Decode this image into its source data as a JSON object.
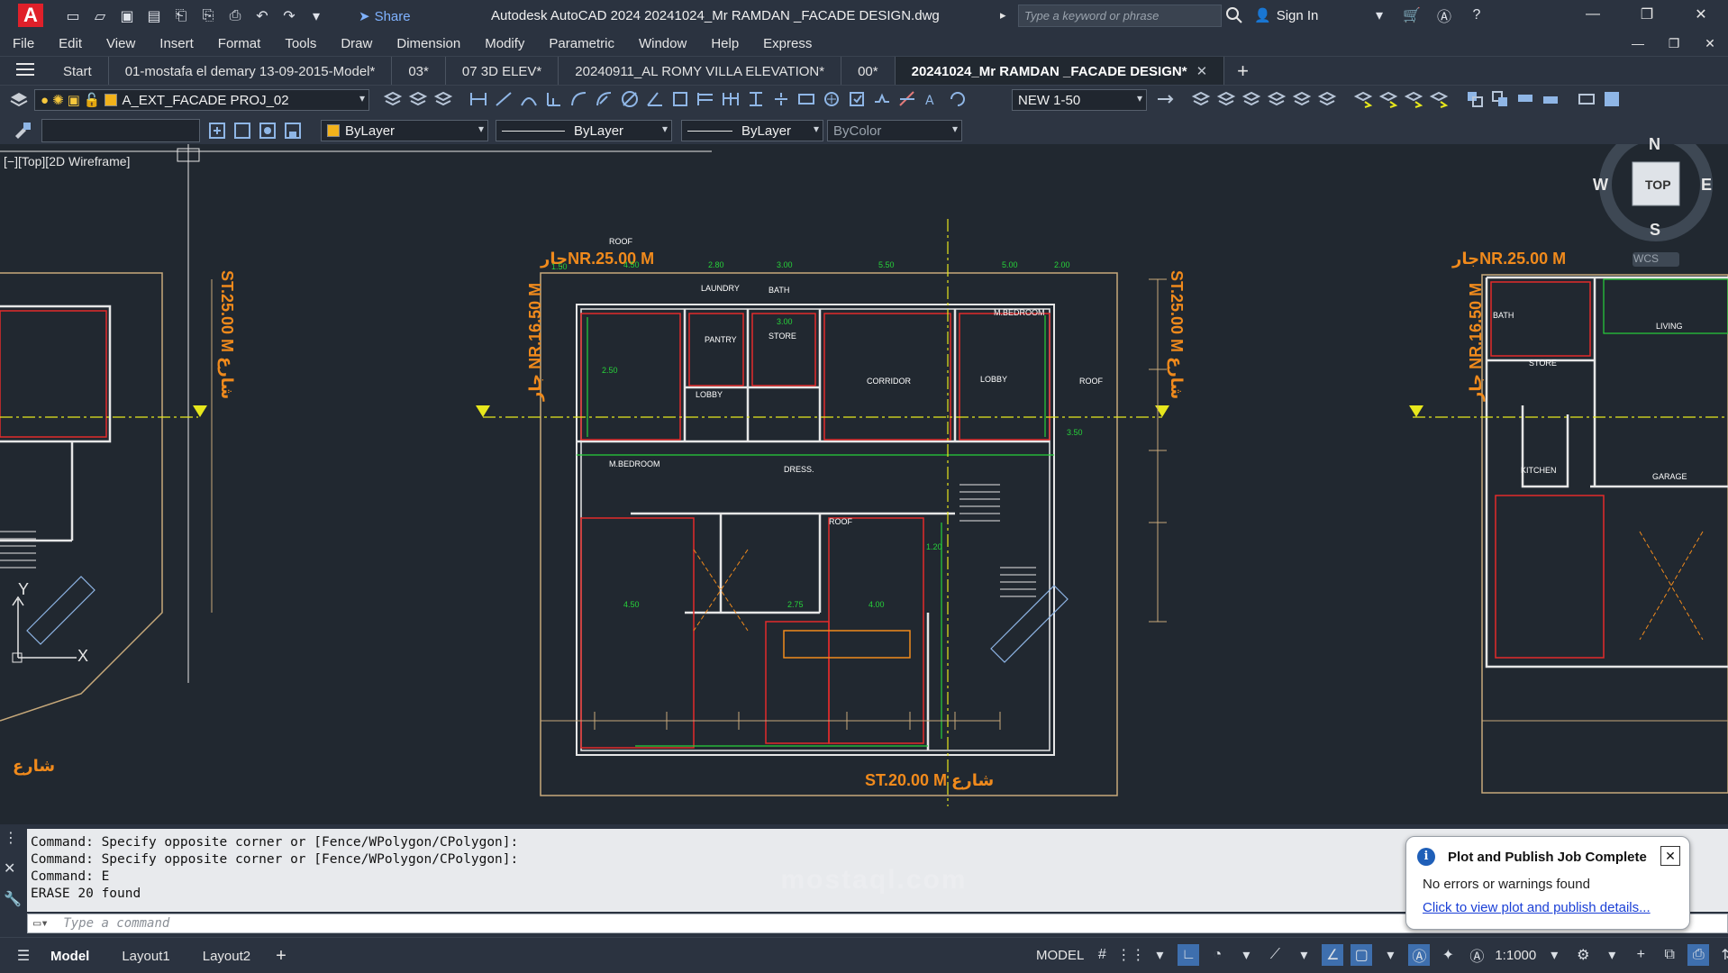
{
  "titlebar": {
    "app_logo": "A",
    "share_label": "Share",
    "app_title": "Autodesk AutoCAD 2024   20241024_Mr RAMDAN _FACADE DESIGN.dwg",
    "search_placeholder": "Type a keyword or phrase",
    "signin_label": "Sign In"
  },
  "menu": [
    "File",
    "Edit",
    "View",
    "Insert",
    "Format",
    "Tools",
    "Draw",
    "Dimension",
    "Modify",
    "Parametric",
    "Window",
    "Help",
    "Express"
  ],
  "tabs": [
    {
      "label": "Start"
    },
    {
      "label": "01-mostafa el demary 13-09-2015-Model*"
    },
    {
      "label": "03*"
    },
    {
      "label": "07 3D ELEV*"
    },
    {
      "label": "20240911_AL ROMY VILLA ELEVATION*"
    },
    {
      "label": "00*"
    },
    {
      "label": "20241024_Mr RAMDAN _FACADE DESIGN*",
      "close": "✕"
    }
  ],
  "new_tab": "+",
  "ribbon": {
    "layer_name": "A_EXT_FACADE PROJ_02",
    "scale_value": "NEW 1-50",
    "color_value": "ByLayer",
    "linetype_value": "ByLayer",
    "lineweight_value": "ByLayer",
    "plotstyle_value": "ByColor"
  },
  "viewport": {
    "label": "[−][Top][2D Wireframe]",
    "viewcube": {
      "top": "TOP",
      "n": "N",
      "s": "S",
      "e": "E",
      "w": "W",
      "wcs": "WCS"
    },
    "ucs": {
      "x": "X",
      "y": "Y"
    }
  },
  "drawing": {
    "neighbor_top": "جارNR.25.00  M",
    "neighbor_top_right": "جارNR.25.00  M",
    "neighbor_left": "جار NR.16.50 M",
    "neighbor_left_right": "جار NR.16.50 M",
    "street_side": "ST.25.00  M شارع",
    "street_side_left": "ST.25.00  M شارع",
    "street_bottom": "ST.20.00  M  شارع",
    "street_left": "شارع",
    "rooms": [
      "ROOF",
      "LAUNDRY",
      "BATH",
      "M.BEDROOM",
      "STORE",
      "PANTRY",
      "LOBBY",
      "CORRIDOR",
      "DRESS.",
      "M.BEDROOM",
      "ROOF",
      "LOBBY",
      "ROOF",
      "STORE",
      "KITCHEN",
      "LIVING",
      "GARAGE",
      "BATH"
    ],
    "dims": [
      "4.50",
      "2.80",
      "3.00",
      "5.50",
      "5.00",
      "2.00",
      "2.50",
      "3.00",
      "4.50",
      "2.75",
      "4.00",
      "3.50",
      "1.20",
      "1.50"
    ]
  },
  "command": {
    "history": [
      "Command: Specify opposite corner or [Fence/WPolygon/CPolygon]:",
      "Command: Specify opposite corner or [Fence/WPolygon/CPolygon]:",
      "Command: E",
      "ERASE 20 found"
    ],
    "input_placeholder": "Type a command"
  },
  "notification": {
    "title": "Plot and Publish Job Complete",
    "message": "No errors or warnings found",
    "link": "Click to view plot and publish details..."
  },
  "status": {
    "tabs": [
      "Model",
      "Layout1",
      "Layout2"
    ],
    "add": "+",
    "model_label": "MODEL",
    "scale": "1:1000"
  },
  "watermark": "mostaql.com",
  "colors": {
    "bg": "#212830",
    "walls": "#e6e6e6",
    "orange": "#f08a1c",
    "red": "#e32b2b",
    "green": "#27d23a",
    "yellow": "#e7e71c",
    "tan": "#c7a97a"
  }
}
